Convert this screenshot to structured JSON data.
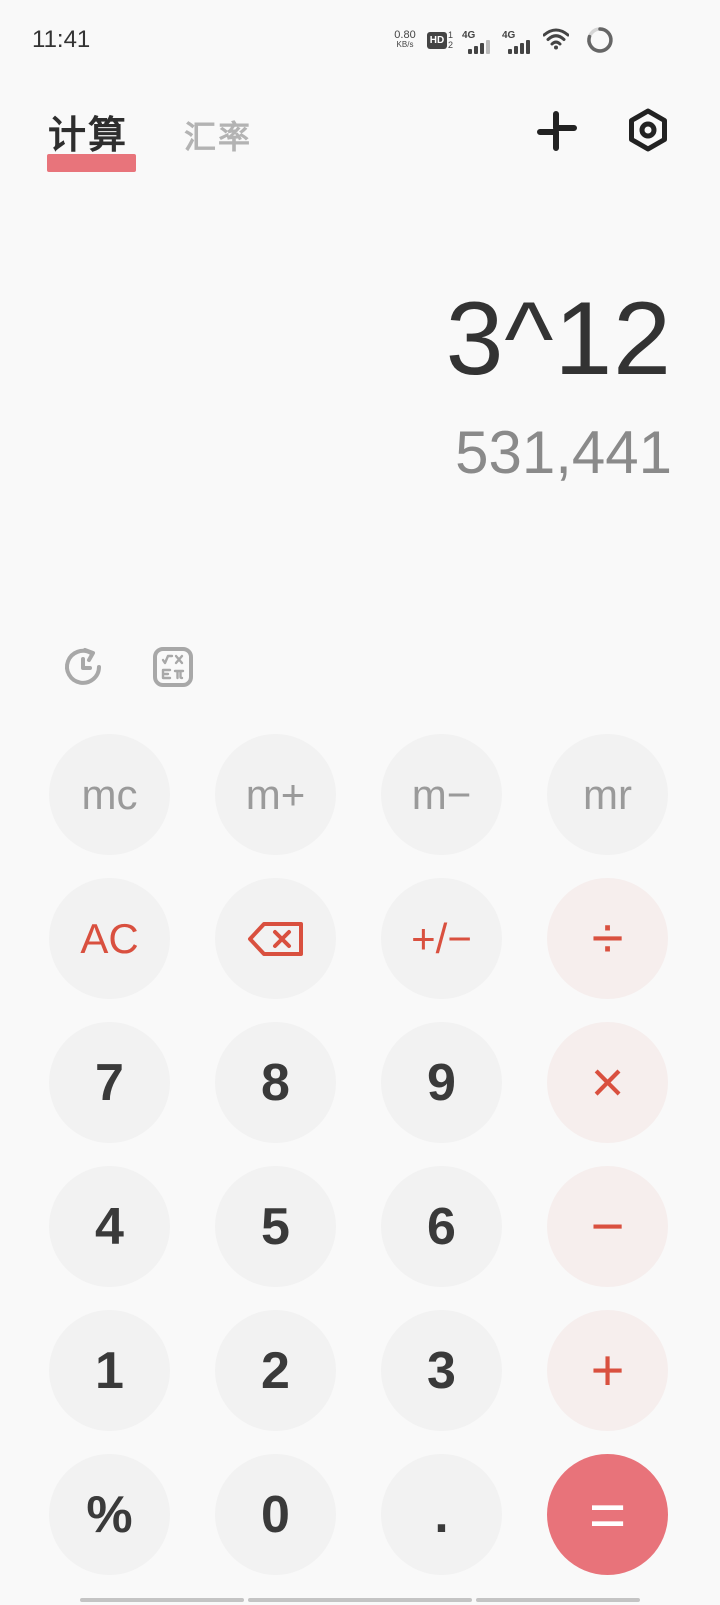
{
  "status_bar": {
    "time": "11:41",
    "net_speed_value": "0.80",
    "net_speed_unit": "KB/s",
    "hd_label": "HD",
    "hd_sub_top": "1",
    "hd_sub_bottom": "2",
    "sim1_label": "4G",
    "sim2_label": "4G"
  },
  "tabs": {
    "calculator": "计算",
    "exchange_rate": "汇率"
  },
  "header_icons": [
    "minimize-icon",
    "settings-icon"
  ],
  "display": {
    "expression": "3^12",
    "result": "531,441"
  },
  "tools": [
    "history-icon",
    "scientific-mode-icon"
  ],
  "keypad": {
    "mc": "mc",
    "m_plus": "m+",
    "m_minus": "m−",
    "mr": "mr",
    "ac": "AC",
    "plus_minus": "+/−",
    "divide": "÷",
    "seven": "7",
    "eight": "8",
    "nine": "9",
    "multiply": "×",
    "four": "4",
    "five": "5",
    "six": "6",
    "minus": "−",
    "one": "1",
    "two": "2",
    "three": "3",
    "plus": "+",
    "percent": "%",
    "zero": "0",
    "decimal": ".",
    "equals": "="
  },
  "colors": {
    "accent": "#e8747b",
    "operator_text": "#d9503f",
    "operator_bg": "#f6eeed",
    "key_bg": "#f2f2f2",
    "background": "#f9f9f9"
  }
}
